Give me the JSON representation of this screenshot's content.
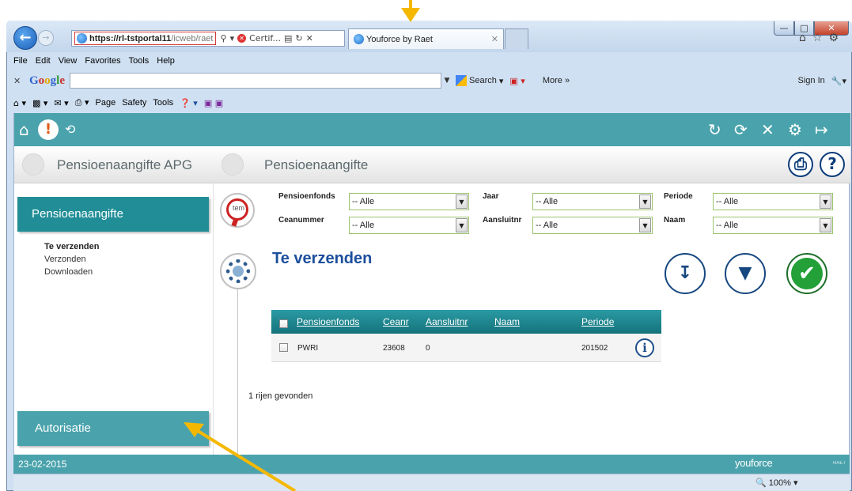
{
  "browser": {
    "url_host": "https://rl-tstportal11",
    "url_rest": "/icweb/raet",
    "cert_label": "Certif...",
    "tab_title": "Youforce by Raet",
    "menu": [
      "File",
      "Edit",
      "View",
      "Favorites",
      "Tools",
      "Help"
    ],
    "google": {
      "search_label": "Search",
      "more_label": "More »",
      "signin_label": "Sign In"
    },
    "commands": [
      "Page",
      "Safety",
      "Tools"
    ]
  },
  "app": {
    "crumbs": [
      "Pensioenaangifte APG",
      "Pensioenaangifte"
    ],
    "sidebar": {
      "header": "Pensioenaangifte",
      "items": [
        "Te verzenden",
        "Verzonden",
        "Downloaden"
      ],
      "footer": "Autorisatie"
    },
    "filters": {
      "pensioenfonds_label": "Pensioenfonds",
      "pensioenfonds_value": "-- Alle",
      "ceanummer_label": "Ceanummer",
      "ceanummer_value": "-- Alle",
      "jaar_label": "Jaar",
      "jaar_value": "-- Alle",
      "aansluitnr_label": "Aansluitnr",
      "aansluitnr_value": "-- Alle",
      "periode_label": "Periode",
      "periode_value": "-- Alle",
      "naam_label": "Naam",
      "naam_value": "-- Alle"
    },
    "section_title": "Te verzenden",
    "grid": {
      "columns": [
        "Pensioenfonds",
        "Ceanr",
        "Aansluitnr",
        "Naam",
        "Periode"
      ],
      "rows": [
        {
          "pensioenfonds": "PWRI",
          "ceanr": "23608",
          "aansluitnr": "0",
          "naam": "",
          "periode": "201502"
        }
      ]
    },
    "rows_found": "1 rijen gevonden",
    "status_date": "23-02-2015",
    "brand": "youforce",
    "brand_small": "RAET",
    "zoom": "100%"
  },
  "colors": {
    "teal": "#4aa3ac",
    "teal_dark": "#218e97",
    "title_blue": "#1c4f9c",
    "annotation_arrow": "#f5b800"
  }
}
